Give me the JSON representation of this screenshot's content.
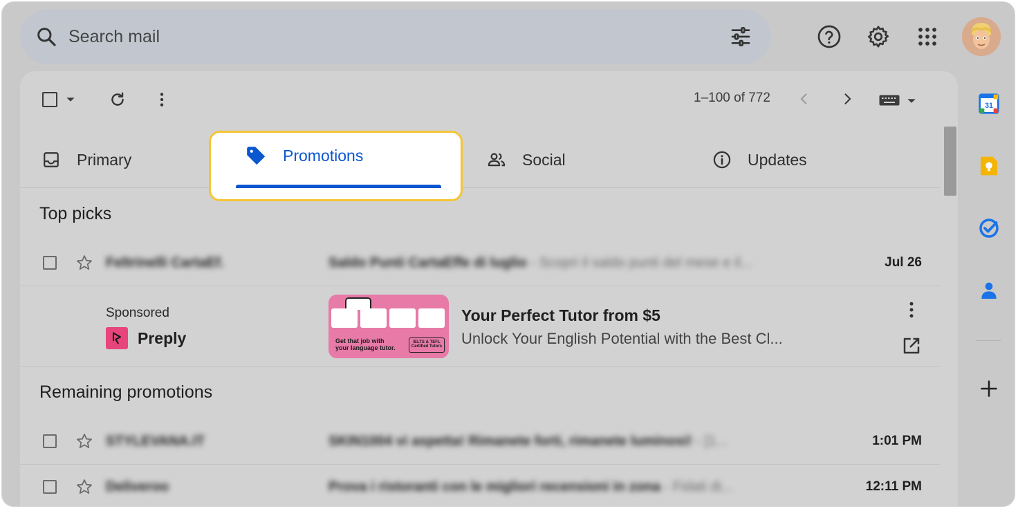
{
  "search": {
    "placeholder": "Search mail"
  },
  "toolbar": {
    "pager": "1–100 of 772"
  },
  "tabs": [
    {
      "label": "Primary"
    },
    {
      "label": "Promotions"
    },
    {
      "label": "Social"
    },
    {
      "label": "Updates"
    }
  ],
  "sections": {
    "top_picks": "Top picks",
    "remaining": "Remaining promotions"
  },
  "top_picks_row": {
    "sender": "Feltrinelli CartaEf.",
    "subject": "Saldo Punti CartaEffe di luglio",
    "snippet": " - Scopri il saldo punti del mese e il...",
    "date": "Jul 26"
  },
  "ad": {
    "sponsored": "Sponsored",
    "brand": "Preply",
    "title": "Your Perfect Tutor from $5",
    "description": "Unlock Your English Potential with the Best Cl...",
    "image_caption": "Get that job with your language tutor.",
    "image_chip": "IELTS & TEFL Certified Tutors"
  },
  "remaining_rows": [
    {
      "sender": "STYLEVANA.IT",
      "subject": "SKIN1004 vi aspetta! Rimanete forti, rimanete luminosi!",
      "snippet": " - [1...",
      "date": "1:01 PM"
    },
    {
      "sender": "Deliveroo",
      "subject": "Prova i ristoranti con le migliori recensioni in zona",
      "snippet": " - Fidati di...",
      "date": "12:11 PM"
    }
  ],
  "colors": {
    "accent": "#0b57d0",
    "highlight": "#f4c535",
    "preply": "#e8457c"
  }
}
